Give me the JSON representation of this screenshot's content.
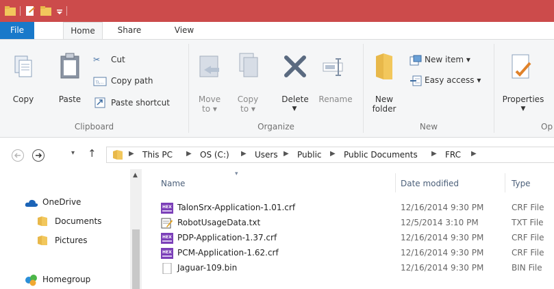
{
  "tabs": {
    "file": "File",
    "home": "Home",
    "share": "Share",
    "view": "View"
  },
  "clipboard": {
    "copy": "Copy",
    "paste": "Paste",
    "cut": "Cut",
    "copy_path": "Copy path",
    "paste_shortcut": "Paste shortcut",
    "label": "Clipboard"
  },
  "organize": {
    "move_to_1": "Move",
    "move_to_2": "to ▾",
    "copy_to_1": "Copy",
    "copy_to_2": "to ▾",
    "delete": "Delete",
    "rename": "Rename",
    "label": "Organize"
  },
  "new_group": {
    "new_folder_1": "New",
    "new_folder_2": "folder",
    "new_item": "New item ▾",
    "easy_access": "Easy access ▾",
    "label": "New"
  },
  "open_group": {
    "properties": "Properties",
    "label": "Op"
  },
  "nav_buttons": {
    "back": "←",
    "forward": "→",
    "recent": "▾",
    "up": "↑"
  },
  "breadcrumb": [
    "This PC",
    "OS (C:)",
    "Users",
    "Public",
    "Public Documents",
    "FRC"
  ],
  "nav_pane": {
    "onedrive": "OneDrive",
    "documents": "Documents",
    "pictures": "Pictures",
    "homegroup": "Homegroup"
  },
  "columns": {
    "name": "Name",
    "date": "Date modified",
    "type": "Type"
  },
  "files": [
    {
      "name": "TalonSrx-Application-1.01.crf",
      "date": "12/16/2014 9:30 PM",
      "type": "CRF File",
      "icon": "hex-file-icon"
    },
    {
      "name": "RobotUsageData.txt",
      "date": "12/5/2014 3:10 PM",
      "type": "TXT File",
      "icon": "text-file-icon"
    },
    {
      "name": "PDP-Application-1.37.crf",
      "date": "12/16/2014 9:30 PM",
      "type": "CRF File",
      "icon": "hex-file-icon"
    },
    {
      "name": "PCM-Application-1.62.crf",
      "date": "12/16/2014 9:30 PM",
      "type": "CRF File",
      "icon": "hex-file-icon"
    },
    {
      "name": "Jaguar-109.bin",
      "date": "12/16/2014 9:30 PM",
      "type": "BIN File",
      "icon": "bin-file-icon"
    }
  ],
  "colors": {
    "titlebar": "#cc4b4b",
    "file_tab": "#1979ca",
    "folder": "#e8b84a"
  }
}
